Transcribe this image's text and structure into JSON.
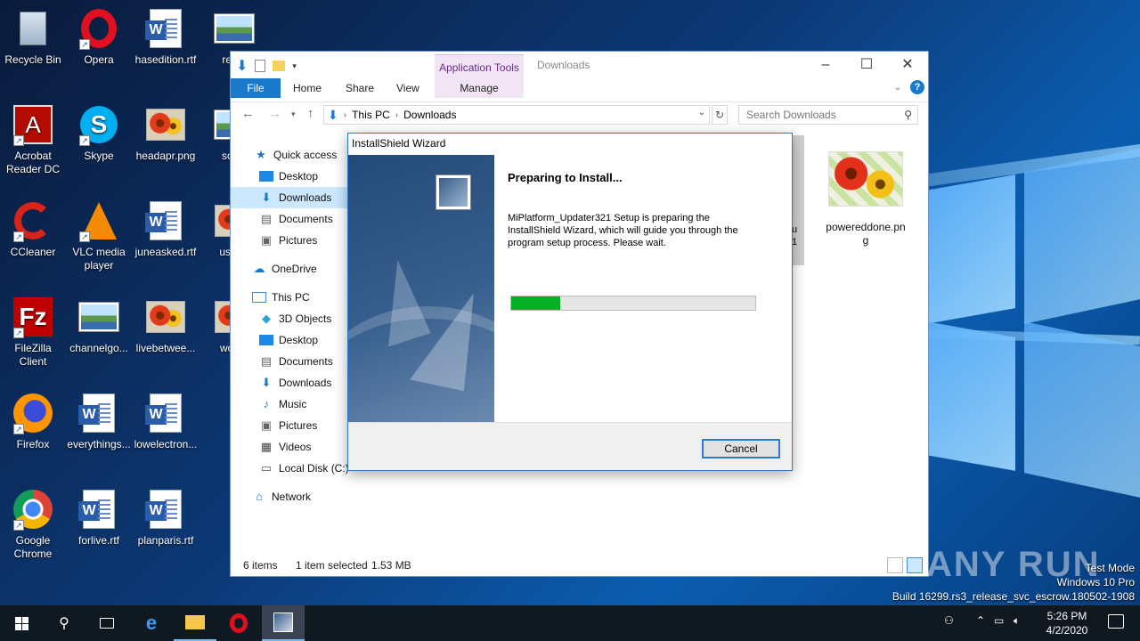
{
  "desktop": {
    "icons": [
      {
        "label": "Recycle Bin",
        "icon": "recycle-bin-icon"
      },
      {
        "label": "Opera",
        "icon": "opera-icon"
      },
      {
        "label": "hasedition.rtf",
        "icon": "word-document-icon"
      },
      {
        "label": "recor",
        "icon": "image-icon"
      },
      {
        "label": "Acrobat Reader DC",
        "icon": "acrobat-icon"
      },
      {
        "label": "Skype",
        "icon": "skype-icon"
      },
      {
        "label": "headapr.png",
        "icon": "image-icon"
      },
      {
        "label": "soluti",
        "icon": "image-icon"
      },
      {
        "label": "CCleaner",
        "icon": "ccleaner-icon"
      },
      {
        "label": "VLC media player",
        "icon": "vlc-icon"
      },
      {
        "label": "juneasked.rtf",
        "icon": "word-document-icon"
      },
      {
        "label": "usersr",
        "icon": "image-icon"
      },
      {
        "label": "FileZilla Client",
        "icon": "filezilla-icon"
      },
      {
        "label": "channelgo...",
        "icon": "image-icon"
      },
      {
        "label": "livebetwee...",
        "icon": "image-icon"
      },
      {
        "label": "wome",
        "icon": "image-icon"
      },
      {
        "label": "Firefox",
        "icon": "firefox-icon"
      },
      {
        "label": "everythings...",
        "icon": "word-document-icon"
      },
      {
        "label": "lowelectron...",
        "icon": "word-document-icon"
      },
      {
        "label": "Google Chrome",
        "icon": "chrome-icon"
      },
      {
        "label": "forlive.rtf",
        "icon": "word-document-icon"
      },
      {
        "label": "planparis.rtf",
        "icon": "word-document-icon"
      }
    ]
  },
  "explorer": {
    "title": "Downloads",
    "context_tab": "Application Tools",
    "tabs": {
      "file": "File",
      "home": "Home",
      "share": "Share",
      "view": "View",
      "manage": "Manage"
    },
    "address": {
      "root": "This PC",
      "current": "Downloads"
    },
    "search_placeholder": "Search Downloads",
    "nav": {
      "quick_access": "Quick access",
      "qa_items": [
        "Desktop",
        "Downloads",
        "Documents",
        "Pictures"
      ],
      "onedrive": "OneDrive",
      "this_pc": "This PC",
      "pc_items": [
        "3D Objects",
        "Desktop",
        "Documents",
        "Downloads",
        "Music",
        "Pictures",
        "Videos",
        "Local Disk (C:)"
      ],
      "network": "Network"
    },
    "partial_file_chars": [
      "u",
      "1"
    ],
    "file_item": "powereddone.png",
    "status": {
      "count": "6 items",
      "selected": "1 item selected",
      "size": "1.53 MB"
    }
  },
  "dialog": {
    "title": "InstallShield Wizard",
    "heading": "Preparing to Install...",
    "message": "MiPlatform_Updater321 Setup is preparing the InstallShield Wizard, which will guide you through the program setup process.  Please wait.",
    "progress_fraction": 0.2,
    "cancel_label": "Cancel"
  },
  "watermark": {
    "line1": "Test Mode",
    "line2": "Windows 10 Pro",
    "line3": "Build 16299.rs3_release_svc_escrow.180502-1908",
    "brand": "ANY RUN"
  },
  "taskbar": {
    "time": "5:26 PM",
    "date": "4/2/2020"
  },
  "colors": {
    "accent": "#1979ca",
    "progress": "#06b025",
    "context_tab": "#f1e4f5"
  }
}
